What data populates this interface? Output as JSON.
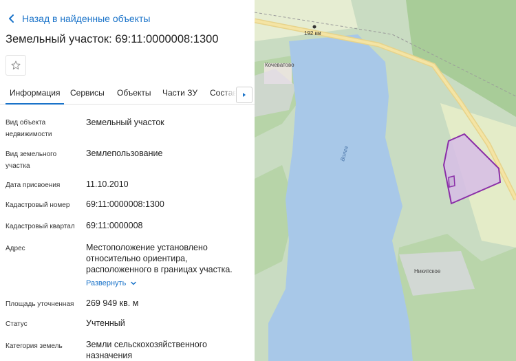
{
  "header": {
    "back_label": "Назад в найденные объекты",
    "title": "Земельный участок: 69:11:0000008:1300"
  },
  "tabs": [
    "Информация",
    "Сервисы",
    "Объекты",
    "Части ЗУ",
    "Состав"
  ],
  "active_tab": "Информация",
  "fields": [
    {
      "label": "Вид объекта недвижимости",
      "value": "Земельный участок"
    },
    {
      "label": "Вид земельного участка",
      "value": "Землепользование"
    },
    {
      "label": "Дата присвоения",
      "value": "11.10.2010"
    },
    {
      "label": "Кадастровый номер",
      "value": "69:11:0000008:1300"
    },
    {
      "label": "Кадастровый квартал",
      "value": "69:11:0000008"
    },
    {
      "label": "Адрес",
      "value": "Местоположение установлено относительно ориентира, расположенного в границах участка."
    },
    {
      "label": "Площадь уточненная",
      "value": "269 949 кв. м"
    },
    {
      "label": "Статус",
      "value": "Учтенный"
    },
    {
      "label": "Категория земель",
      "value": "Земли сельскохозяйственного назначения"
    }
  ],
  "address_expand_label": "Развернуть",
  "map": {
    "road_label": "192 км",
    "places": [
      "Кочеватово",
      "Никитское"
    ],
    "river_label": "Волга",
    "parcel_color": "#8b2fa8"
  },
  "colors": {
    "link": "#1a73c9",
    "water": "#a8c8e8",
    "parcel_fill": "#d7bde6"
  }
}
